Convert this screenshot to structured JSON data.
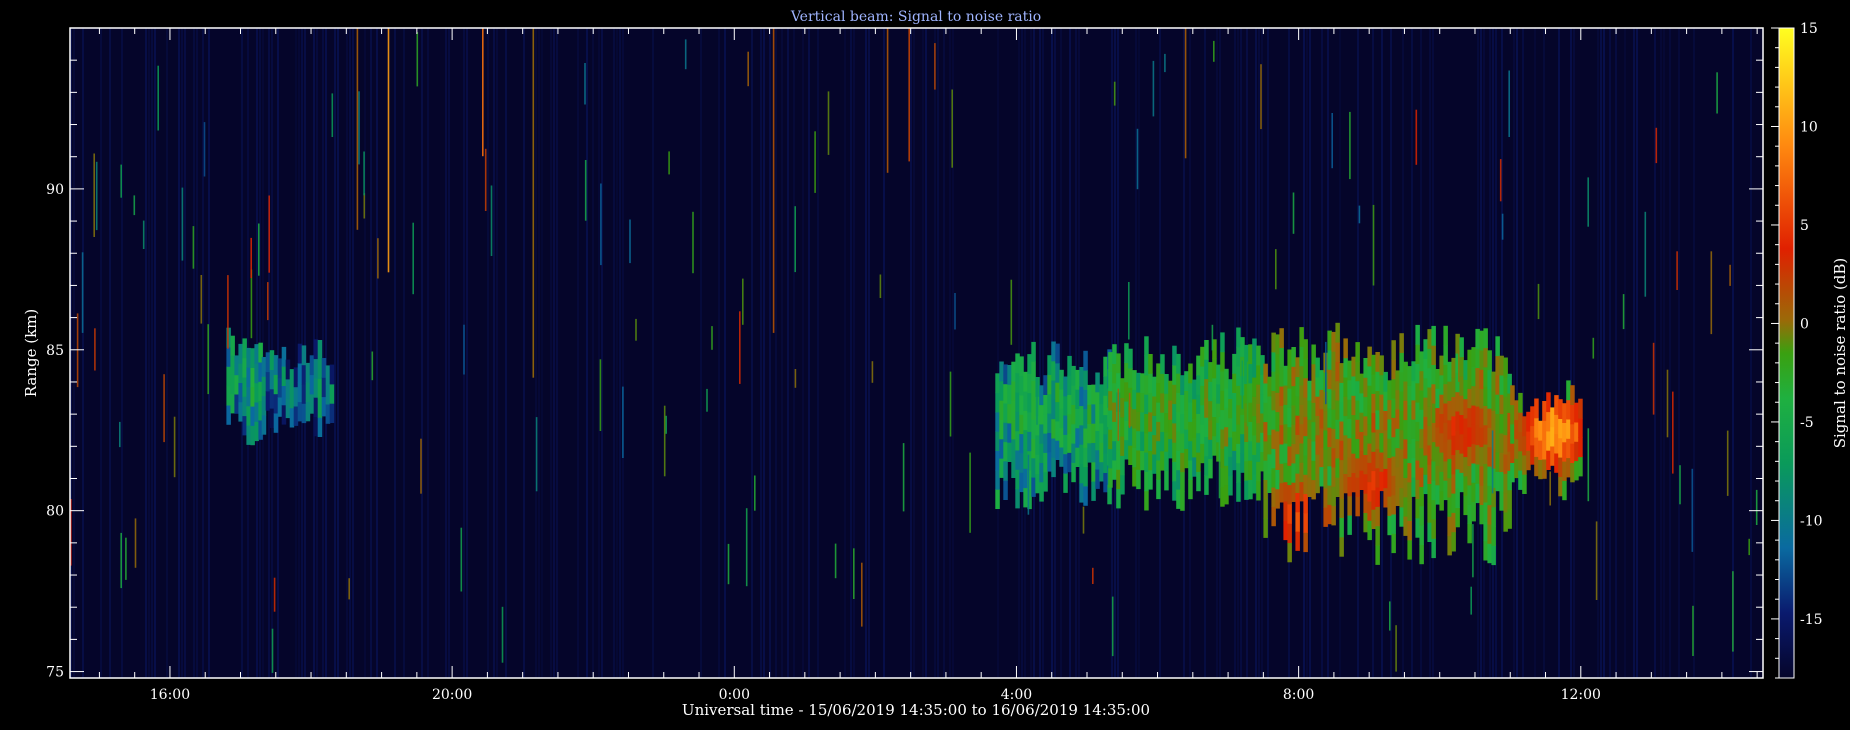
{
  "chart_data": {
    "type": "heatmap",
    "title": "Vertical beam: Signal to noise ratio",
    "xlabel": "Universal time - 15/06/2019 14:35:00 to 16/06/2019 14:35:00",
    "ylabel": "Range (km)",
    "colorbar_label": "Signal to noise ratio (dB)",
    "x_axis": {
      "start_hour": 14.583,
      "end_hour": 38.583,
      "ticks": [
        {
          "hour": 16,
          "label": "16:00"
        },
        {
          "hour": 20,
          "label": "20:00"
        },
        {
          "hour": 24,
          "label": "0:00"
        },
        {
          "hour": 28,
          "label": "4:00"
        },
        {
          "hour": 32,
          "label": "8:00"
        },
        {
          "hour": 36,
          "label": "12:00"
        }
      ]
    },
    "y_axis": {
      "ylim": [
        74.8,
        95
      ],
      "ticks": [
        75,
        80,
        85,
        90
      ]
    },
    "colorbar": {
      "range": [
        -18,
        15
      ],
      "ticks": [
        15,
        10,
        5,
        0,
        -5,
        -10,
        -15
      ],
      "colors": [
        "#05052a",
        "#0a1a6e",
        "#0a6aa0",
        "#0a9a5a",
        "#1fb040",
        "#3aa010",
        "#9a6a08",
        "#e02000",
        "#ff8a10",
        "#ffff20"
      ]
    },
    "background_level_db": -17,
    "echo_regions": [
      {
        "name": "evening-layer-a",
        "hours": [
          16.8,
          17.3
        ],
        "range_km": [
          82,
          85.2
        ],
        "snr_db": -6
      },
      {
        "name": "evening-layer-b",
        "hours": [
          17.3,
          18.3
        ],
        "range_km": [
          82.3,
          84.8
        ],
        "snr_db": -9
      },
      {
        "name": "morning-onset",
        "hours": [
          27.7,
          29.3
        ],
        "range_km": [
          80,
          84.8
        ],
        "snr_db": -5
      },
      {
        "name": "morning-upper",
        "hours": [
          29.3,
          31.5
        ],
        "range_km": [
          80,
          85.2
        ],
        "snr_db": -1
      },
      {
        "name": "morning-main",
        "hours": [
          31.5,
          35.0
        ],
        "range_km": [
          78.3,
          85.5
        ],
        "snr_db": 2
      },
      {
        "name": "morning-late",
        "hours": [
          35.0,
          36.0
        ],
        "range_km": [
          80.3,
          83.6
        ],
        "snr_db": 3
      }
    ],
    "peak_echoes": [
      {
        "hour": 32.0,
        "range_km": 79.5,
        "snr_db": 9
      },
      {
        "hour": 33.0,
        "range_km": 80.5,
        "snr_db": 8
      },
      {
        "hour": 34.3,
        "range_km": 82.2,
        "snr_db": 8
      },
      {
        "hour": 35.6,
        "range_km": 82.2,
        "snr_db": 12
      }
    ],
    "grid": false,
    "legend": "colorbar-right"
  }
}
